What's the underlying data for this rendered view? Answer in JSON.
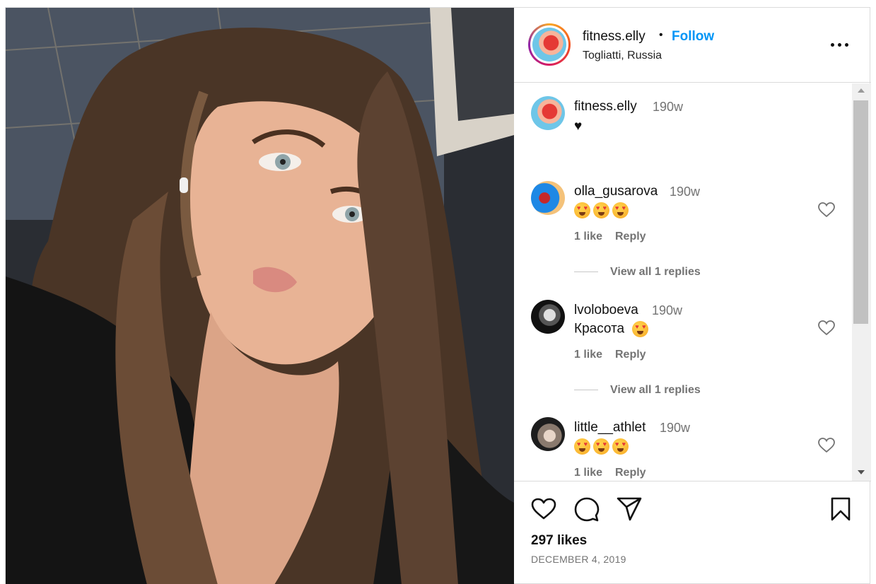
{
  "post": {
    "author": "fitness.elly",
    "location": "Togliatti, Russia",
    "follow_label": "Follow",
    "separator": "•"
  },
  "caption": {
    "user": "fitness.elly",
    "time": "190w",
    "text": "♥"
  },
  "comments": [
    {
      "user": "olla_gusarova",
      "time": "190w",
      "text": "",
      "emoji_count": 3,
      "likes": "1 like",
      "reply": "Reply",
      "replies": "View all 1 replies"
    },
    {
      "user": "lvoloboeva",
      "time": "190w",
      "text": "Красота",
      "emoji_count": 1,
      "likes": "1 like",
      "reply": "Reply",
      "replies": "View all 1 replies"
    },
    {
      "user": "little__athlet",
      "time": "190w",
      "text": "",
      "emoji_count": 3,
      "likes": "1 like",
      "reply": "Reply"
    }
  ],
  "footer": {
    "likes": "297 likes",
    "date": "DECEMBER 4, 2019"
  },
  "icons": {
    "like": "heart-icon",
    "comment": "comment-icon",
    "share": "share-icon",
    "save": "bookmark-icon",
    "more": "more-icon"
  },
  "colors": {
    "follow": "#0095f6",
    "muted": "#737373",
    "border": "#dbdbdb"
  }
}
